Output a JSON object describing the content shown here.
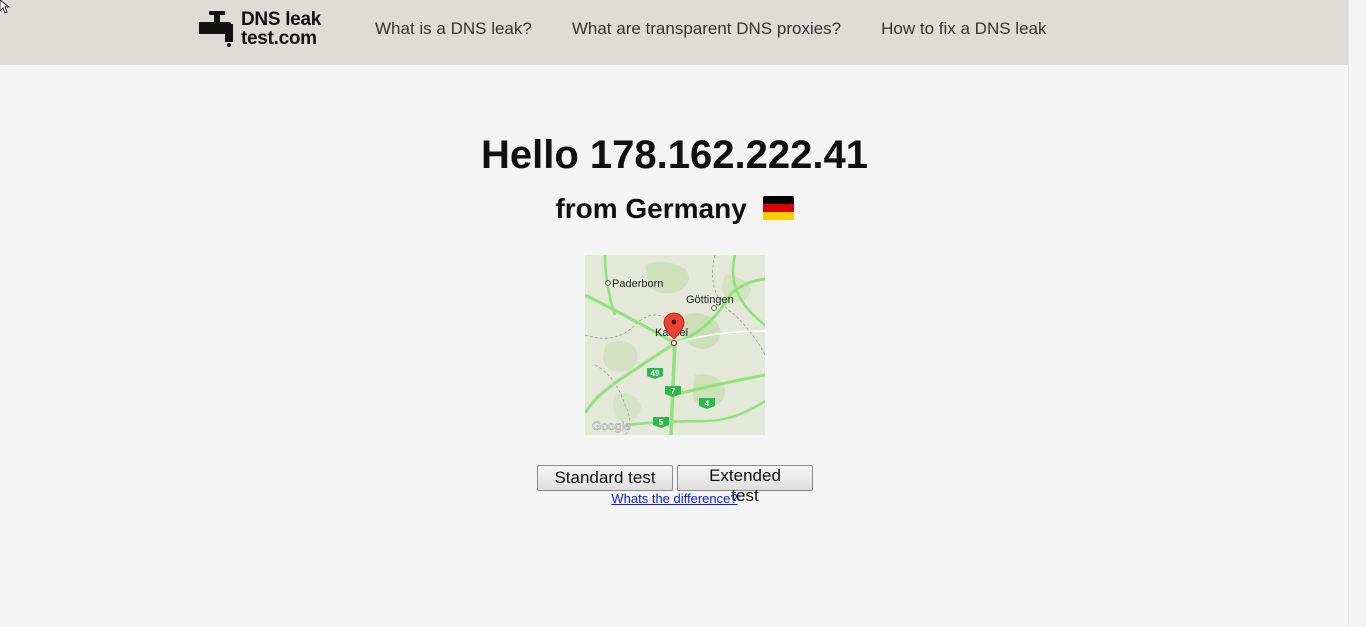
{
  "header": {
    "logo_line1": "DNS leak",
    "logo_line2": "test.com",
    "nav": [
      {
        "label": "What is a DNS leak?"
      },
      {
        "label": "What are transparent DNS proxies?"
      },
      {
        "label": "How to fix a DNS leak"
      }
    ]
  },
  "main": {
    "greeting": "Hello 178.162.222.41",
    "location": "from Germany",
    "flag_colors": [
      "#000000",
      "#dd0000",
      "#ffce00"
    ],
    "map": {
      "cities": [
        "Paderborn",
        "Göttingen",
        "Kassel"
      ],
      "road_labels": [
        "49",
        "7",
        "4",
        "5"
      ],
      "attribution": "Google"
    },
    "buttons": {
      "standard": "Standard test",
      "extended": "Extended test"
    },
    "difference_link": "Whats the difference?"
  },
  "colors": {
    "header_bg": "#dedcd6",
    "page_bg": "#f4f4f4",
    "link": "#0b1ee0"
  }
}
